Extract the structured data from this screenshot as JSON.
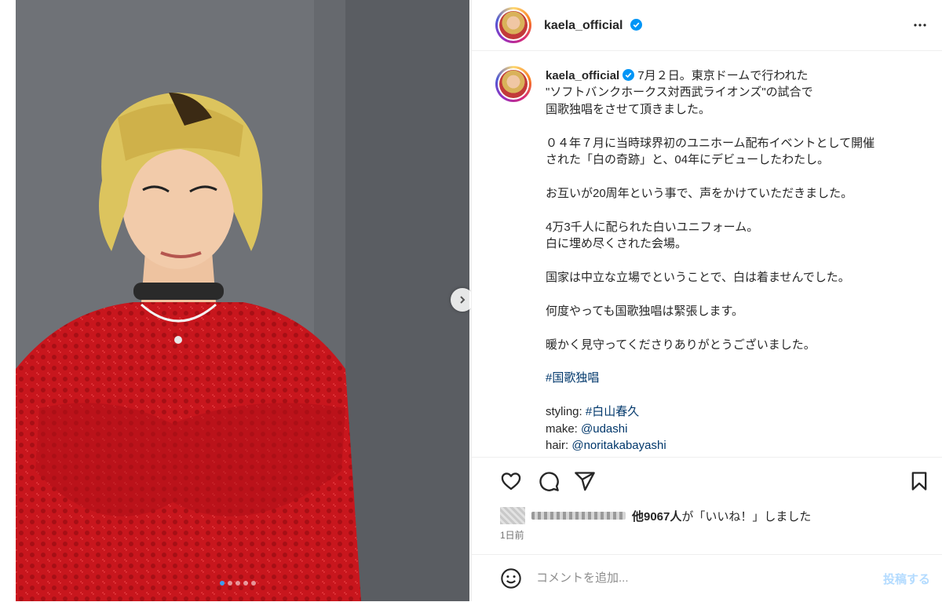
{
  "post": {
    "username": "kaela_official",
    "verified": true,
    "caption_lines": [
      "7月２日。東京ドームで行われた",
      "\"ソフトバンクホークス対西武ライオンズ\"の試合で",
      "国歌独唱をさせて頂きました。",
      "",
      "０４年７月に当時球界初のユニホーム配布イベントとして開催",
      "された「白の奇跡」と、04年にデビューしたわたし。",
      "",
      "お互いが20周年という事で、声をかけていただきました。",
      "",
      "4万3千人に配られた白いユニフォーム。",
      "白に埋め尽くされた会場。",
      "",
      "国家は中立な立場でということで、白は着ませんでした。",
      "",
      "何度やっても国歌独唱は緊張します。",
      "",
      "暖かく見守ってくださりありがとうございました。",
      ""
    ],
    "hashtag": "#国歌独唱",
    "credits": [
      {
        "label": "styling: ",
        "value": "#白山春久"
      },
      {
        "label": "make: ",
        "value": "@udashi"
      },
      {
        "label": "hair: ",
        "value": "@noritakabayashi"
      }
    ]
  },
  "likes": {
    "count_text": "他9067人",
    "suffix": "が「いいね！」しました"
  },
  "timestamp": "1日前",
  "comment": {
    "placeholder": "コメントを追加...",
    "post_label": "投稿する"
  },
  "carousel": {
    "dot_count": 5,
    "active_index": 0
  },
  "colors": {
    "verified": "#0095f6",
    "link": "#00376b",
    "post_button_disabled": "#b3dbff",
    "dress": "#c8161d"
  },
  "icons": {
    "like": "heart-icon",
    "comment": "comment-icon",
    "share": "share-icon",
    "save": "bookmark-icon",
    "emoji": "emoji-icon",
    "more": "more-options-icon",
    "next": "chevron-right-icon"
  }
}
